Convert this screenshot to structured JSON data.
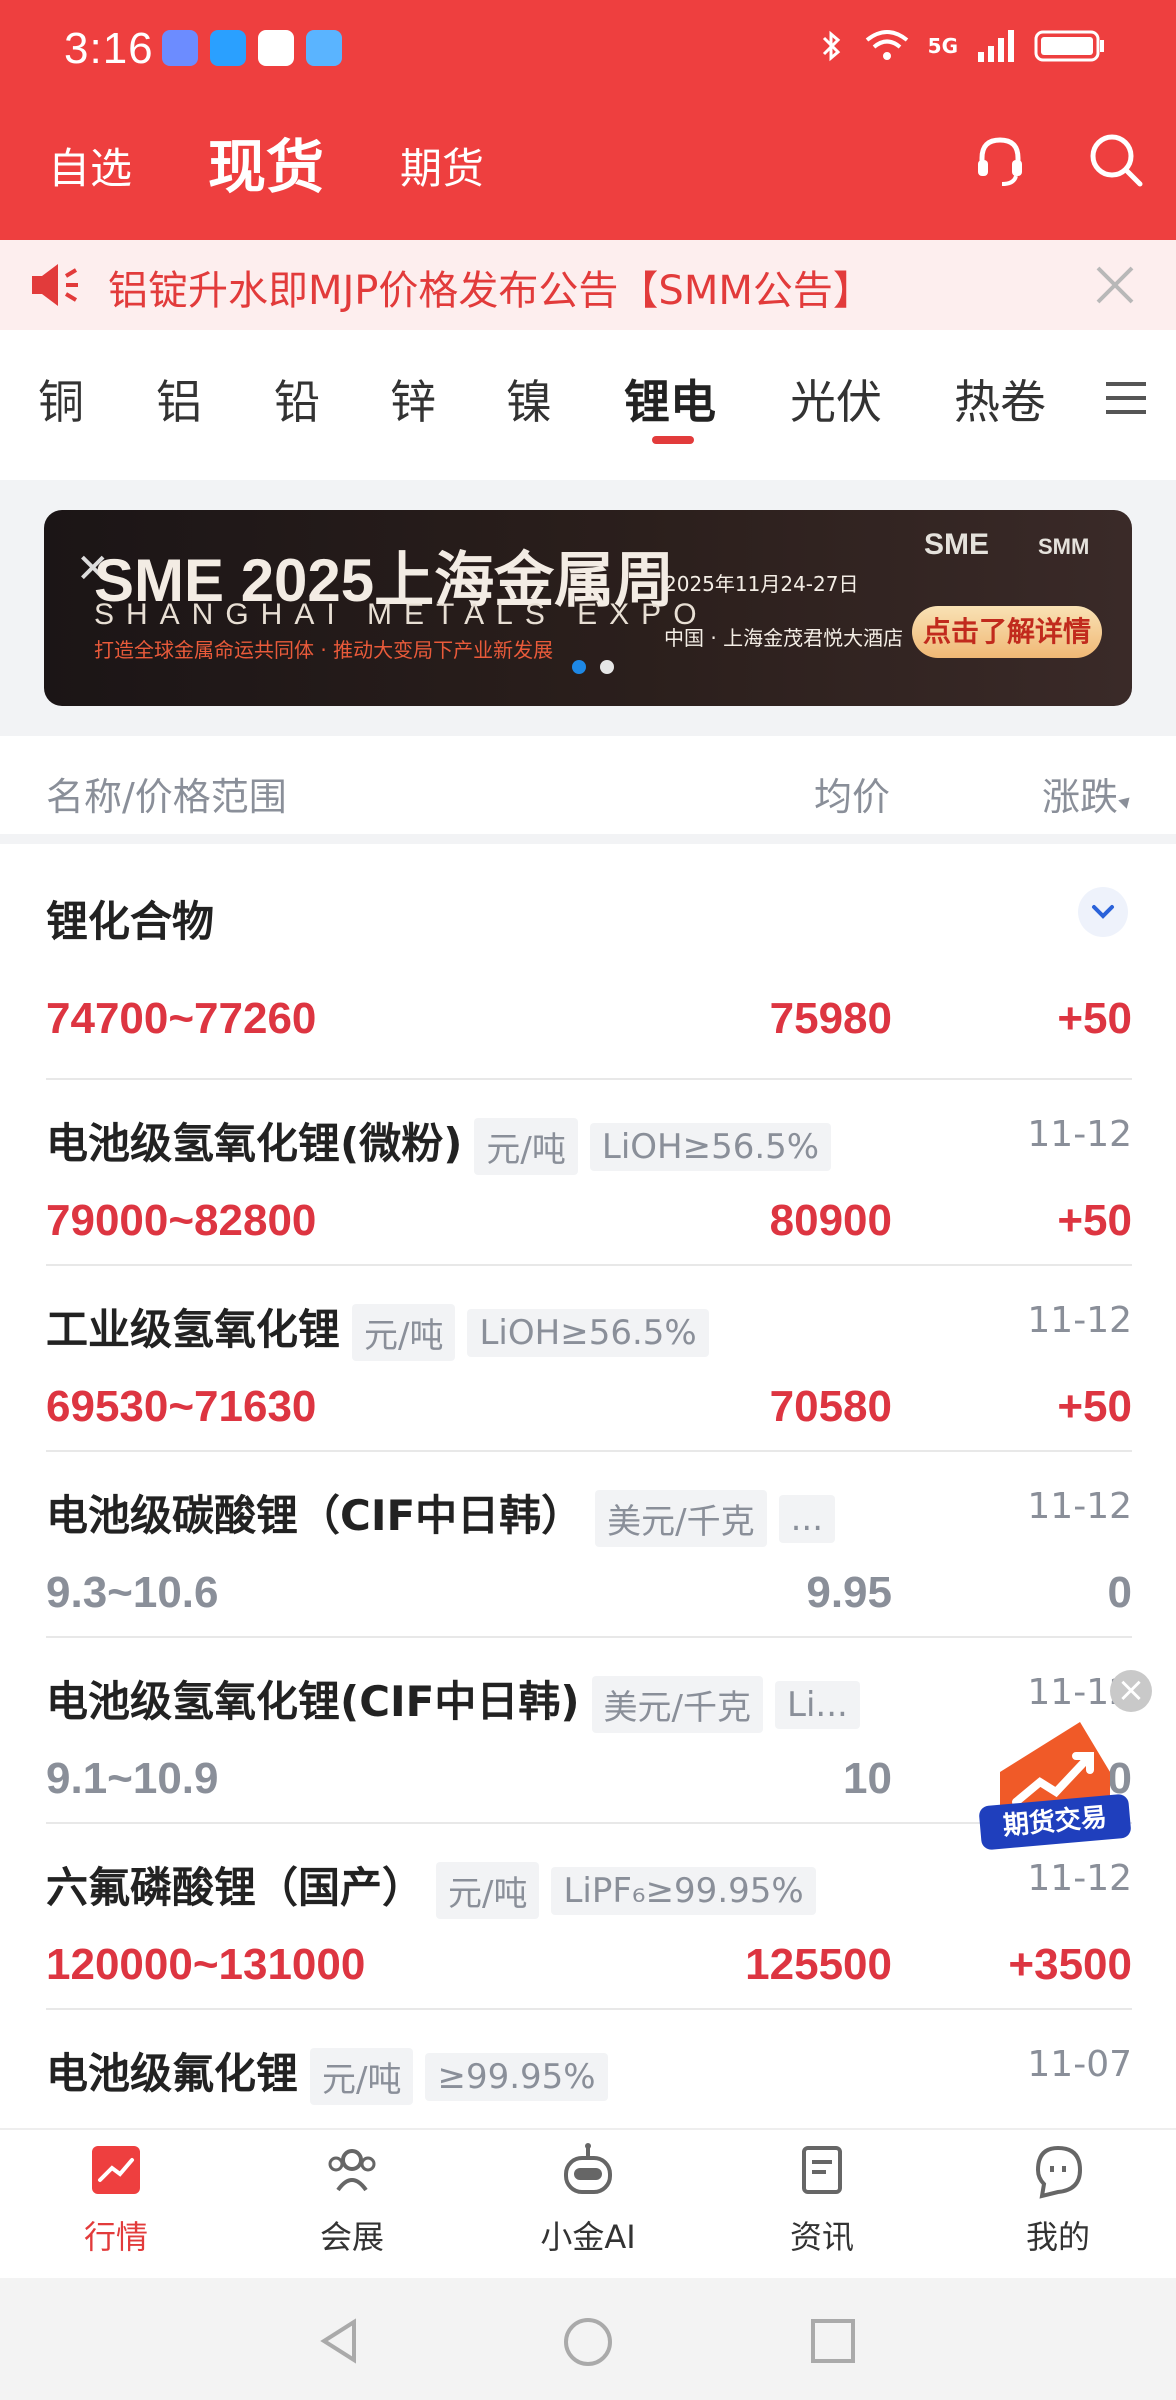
{
  "status_bar": {
    "time": "3:16",
    "network": "5G"
  },
  "header": {
    "tabs": [
      {
        "label": "自选"
      },
      {
        "label": "现货"
      },
      {
        "label": "期货"
      }
    ]
  },
  "notice": {
    "text": "铝锭升水即MJP价格发布公告【SMM公告】"
  },
  "categories": [
    "铜",
    "铝",
    "铅",
    "锌",
    "镍",
    "锂电",
    "光伏",
    "热卷"
  ],
  "banner": {
    "title": "SME 2025上海金属周",
    "subtitle": "SHANGHAI METALS EXPO",
    "tagline": "打造全球金属命运共同体 · 推动大变局下产业新发展",
    "date": "2025年11月24-27日",
    "venue": "中国 · 上海金茂君悦大酒店",
    "logo": "SME",
    "logo2": "SMM",
    "cta": "点击了解详情"
  },
  "list_header": {
    "name": "名称/价格范围",
    "avg": "均价",
    "change": "涨跌"
  },
  "group": {
    "title": "锂化合物"
  },
  "rows": [
    {
      "name": "",
      "unit": "",
      "spec": "",
      "date": "",
      "range": "74700~77260",
      "avg": "75980",
      "change": "+50"
    },
    {
      "name": "电池级氢氧化锂(微粉)",
      "unit": "元/吨",
      "spec": "LiOH≥56.5%",
      "date": "11-12",
      "range": "79000~82800",
      "avg": "80900",
      "change": "+50"
    },
    {
      "name": "工业级氢氧化锂",
      "unit": "元/吨",
      "spec": "LiOH≥56.5%",
      "date": "11-12",
      "range": "69530~71630",
      "avg": "70580",
      "change": "+50"
    },
    {
      "name": "电池级碳酸锂（CIF中日韩）",
      "unit": "美元/千克",
      "spec": "...",
      "date": "11-12",
      "range": "9.3~10.6",
      "avg": "9.95",
      "change": "0"
    },
    {
      "name": "电池级氢氧化锂(CIF中日韩)",
      "unit": "美元/千克",
      "spec": "Li...",
      "date": "11-12",
      "range": "9.1~10.9",
      "avg": "10",
      "change": "0"
    },
    {
      "name": "六氟磷酸锂（国产）",
      "unit": "元/吨",
      "spec": "LiPF₆≥99.95%",
      "date": "11-12",
      "range": "120000~131000",
      "avg": "125500",
      "change": "+3500"
    },
    {
      "name": "电池级氟化锂",
      "unit": "元/吨",
      "spec": "≥99.95%",
      "date": "11-07",
      "range": "",
      "avg": "",
      "change": ""
    }
  ],
  "float_badge": {
    "label": "期货交易"
  },
  "bottom_nav": [
    {
      "label": "行情"
    },
    {
      "label": "会展"
    },
    {
      "label": "小金AI"
    },
    {
      "label": "资讯"
    },
    {
      "label": "我的"
    }
  ],
  "colors": {
    "brand_red": "#ee3f3f",
    "up": "#dd3541",
    "flat": "#8a8f99"
  }
}
